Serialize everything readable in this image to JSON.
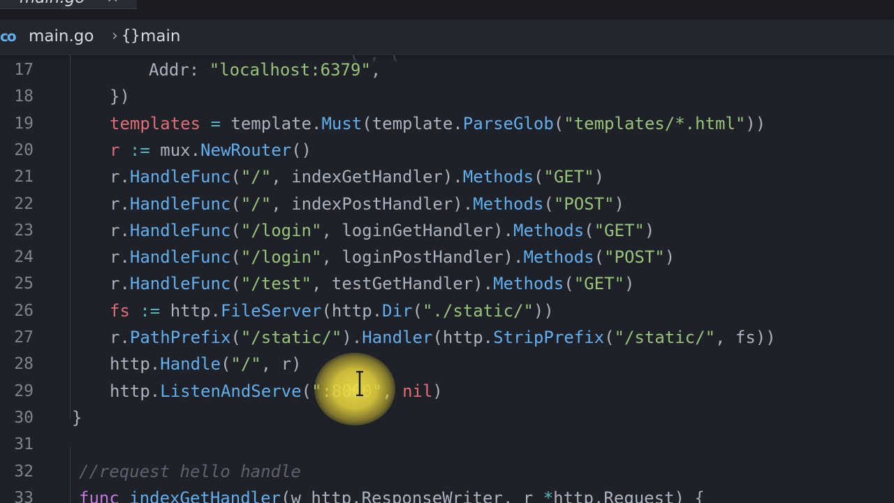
{
  "tab": {
    "title": "main.go",
    "close_glyph": "×"
  },
  "breadcrumb": {
    "icon": "go-file-icon",
    "icon_text": "co",
    "file": "main.go",
    "separator": "›",
    "symbol_glyph": "{}",
    "symbol": "main"
  },
  "colors": {
    "background": "#1e2127",
    "plain": "#abb2bf",
    "keyword": "#c678dd",
    "variable": "#e06c75",
    "function": "#61afef",
    "string": "#98c379",
    "operator": "#56b6c2",
    "comment": "#5c6370",
    "line_number": "#7f848e",
    "cursor_highlight": "#e6d244"
  },
  "lines": [
    {
      "num": "17",
      "indent": 2,
      "tokens": [
        {
          "t": "Addr: ",
          "c": "plain"
        },
        {
          "t": "\"localhost:6379\"",
          "c": "string"
        },
        {
          "t": ",",
          "c": "plain"
        }
      ]
    },
    {
      "num": "18",
      "indent": 1,
      "tokens": [
        {
          "t": "})",
          "c": "plain"
        }
      ]
    },
    {
      "num": "19",
      "indent": 1,
      "tokens": [
        {
          "t": "templates",
          "c": "variable"
        },
        {
          "t": " = ",
          "c": "operator"
        },
        {
          "t": "template.",
          "c": "plain"
        },
        {
          "t": "Must",
          "c": "function"
        },
        {
          "t": "(template.",
          "c": "plain"
        },
        {
          "t": "ParseGlob",
          "c": "function"
        },
        {
          "t": "(",
          "c": "plain"
        },
        {
          "t": "\"templates/*.html\"",
          "c": "string"
        },
        {
          "t": "))",
          "c": "plain"
        }
      ]
    },
    {
      "num": "20",
      "indent": 1,
      "tokens": [
        {
          "t": "r",
          "c": "variable"
        },
        {
          "t": " := ",
          "c": "operator"
        },
        {
          "t": "mux.",
          "c": "plain"
        },
        {
          "t": "NewRouter",
          "c": "function"
        },
        {
          "t": "()",
          "c": "plain"
        }
      ]
    },
    {
      "num": "21",
      "indent": 1,
      "tokens": [
        {
          "t": "r.",
          "c": "plain"
        },
        {
          "t": "HandleFunc",
          "c": "function"
        },
        {
          "t": "(",
          "c": "plain"
        },
        {
          "t": "\"/\"",
          "c": "string"
        },
        {
          "t": ", indexGetHandler).",
          "c": "plain"
        },
        {
          "t": "Methods",
          "c": "function"
        },
        {
          "t": "(",
          "c": "plain"
        },
        {
          "t": "\"GET\"",
          "c": "string"
        },
        {
          "t": ")",
          "c": "plain"
        }
      ]
    },
    {
      "num": "22",
      "indent": 1,
      "tokens": [
        {
          "t": "r.",
          "c": "plain"
        },
        {
          "t": "HandleFunc",
          "c": "function"
        },
        {
          "t": "(",
          "c": "plain"
        },
        {
          "t": "\"/\"",
          "c": "string"
        },
        {
          "t": ", indexPostHandler).",
          "c": "plain"
        },
        {
          "t": "Methods",
          "c": "function"
        },
        {
          "t": "(",
          "c": "plain"
        },
        {
          "t": "\"POST\"",
          "c": "string"
        },
        {
          "t": ")",
          "c": "plain"
        }
      ]
    },
    {
      "num": "23",
      "indent": 1,
      "tokens": [
        {
          "t": "r.",
          "c": "plain"
        },
        {
          "t": "HandleFunc",
          "c": "function"
        },
        {
          "t": "(",
          "c": "plain"
        },
        {
          "t": "\"/login\"",
          "c": "string"
        },
        {
          "t": ", loginGetHandler).",
          "c": "plain"
        },
        {
          "t": "Methods",
          "c": "function"
        },
        {
          "t": "(",
          "c": "plain"
        },
        {
          "t": "\"GET\"",
          "c": "string"
        },
        {
          "t": ")",
          "c": "plain"
        }
      ]
    },
    {
      "num": "24",
      "indent": 1,
      "tokens": [
        {
          "t": "r.",
          "c": "plain"
        },
        {
          "t": "HandleFunc",
          "c": "function"
        },
        {
          "t": "(",
          "c": "plain"
        },
        {
          "t": "\"/login\"",
          "c": "string"
        },
        {
          "t": ", loginPostHandler).",
          "c": "plain"
        },
        {
          "t": "Methods",
          "c": "function"
        },
        {
          "t": "(",
          "c": "plain"
        },
        {
          "t": "\"POST\"",
          "c": "string"
        },
        {
          "t": ")",
          "c": "plain"
        }
      ]
    },
    {
      "num": "25",
      "indent": 1,
      "tokens": [
        {
          "t": "r.",
          "c": "plain"
        },
        {
          "t": "HandleFunc",
          "c": "function"
        },
        {
          "t": "(",
          "c": "plain"
        },
        {
          "t": "\"/test\"",
          "c": "string"
        },
        {
          "t": ", testGetHandler).",
          "c": "plain"
        },
        {
          "t": "Methods",
          "c": "function"
        },
        {
          "t": "(",
          "c": "plain"
        },
        {
          "t": "\"GET\"",
          "c": "string"
        },
        {
          "t": ")",
          "c": "plain"
        }
      ]
    },
    {
      "num": "26",
      "indent": 1,
      "tokens": [
        {
          "t": "fs",
          "c": "variable"
        },
        {
          "t": " := ",
          "c": "operator"
        },
        {
          "t": "http.",
          "c": "plain"
        },
        {
          "t": "FileServer",
          "c": "function"
        },
        {
          "t": "(http.",
          "c": "plain"
        },
        {
          "t": "Dir",
          "c": "function"
        },
        {
          "t": "(",
          "c": "plain"
        },
        {
          "t": "\"./static/\"",
          "c": "string"
        },
        {
          "t": "))",
          "c": "plain"
        }
      ]
    },
    {
      "num": "27",
      "indent": 1,
      "tokens": [
        {
          "t": "r.",
          "c": "plain"
        },
        {
          "t": "PathPrefix",
          "c": "function"
        },
        {
          "t": "(",
          "c": "plain"
        },
        {
          "t": "\"/static/\"",
          "c": "string"
        },
        {
          "t": ").",
          "c": "plain"
        },
        {
          "t": "Handler",
          "c": "function"
        },
        {
          "t": "(http.",
          "c": "plain"
        },
        {
          "t": "StripPrefix",
          "c": "function"
        },
        {
          "t": "(",
          "c": "plain"
        },
        {
          "t": "\"/static/\"",
          "c": "string"
        },
        {
          "t": ", fs))",
          "c": "plain"
        }
      ]
    },
    {
      "num": "28",
      "indent": 1,
      "tokens": [
        {
          "t": "http.",
          "c": "plain"
        },
        {
          "t": "Handle",
          "c": "function"
        },
        {
          "t": "(",
          "c": "plain"
        },
        {
          "t": "\"/\"",
          "c": "string"
        },
        {
          "t": ", r)",
          "c": "plain"
        }
      ]
    },
    {
      "num": "29",
      "indent": 1,
      "tokens": [
        {
          "t": "http.",
          "c": "plain"
        },
        {
          "t": "ListenAndServe",
          "c": "function"
        },
        {
          "t": "(",
          "c": "plain"
        },
        {
          "t": "\":8000\"",
          "c": "string"
        },
        {
          "t": ", ",
          "c": "plain"
        },
        {
          "t": "nil",
          "c": "variable"
        },
        {
          "t": ")",
          "c": "plain"
        }
      ]
    },
    {
      "num": "30",
      "indent": 0,
      "tokens": [
        {
          "t": "}",
          "c": "plain"
        }
      ]
    },
    {
      "num": "31",
      "indent": 0,
      "tokens": []
    },
    {
      "num": "32",
      "indent": 0,
      "tokens": [
        {
          "t": "//request hello handle",
          "c": "comment",
          "italic": true
        }
      ]
    },
    {
      "num": "33",
      "indent": 0,
      "tokens": [
        {
          "t": "func",
          "c": "keyword"
        },
        {
          "t": " ",
          "c": "plain"
        },
        {
          "t": "indexGetHandler",
          "c": "function"
        },
        {
          "t": "(w http.ResponseWriter, r ",
          "c": "plain"
        },
        {
          "t": "*",
          "c": "operator"
        },
        {
          "t": "http.Request) {",
          "c": "plain"
        }
      ]
    }
  ]
}
